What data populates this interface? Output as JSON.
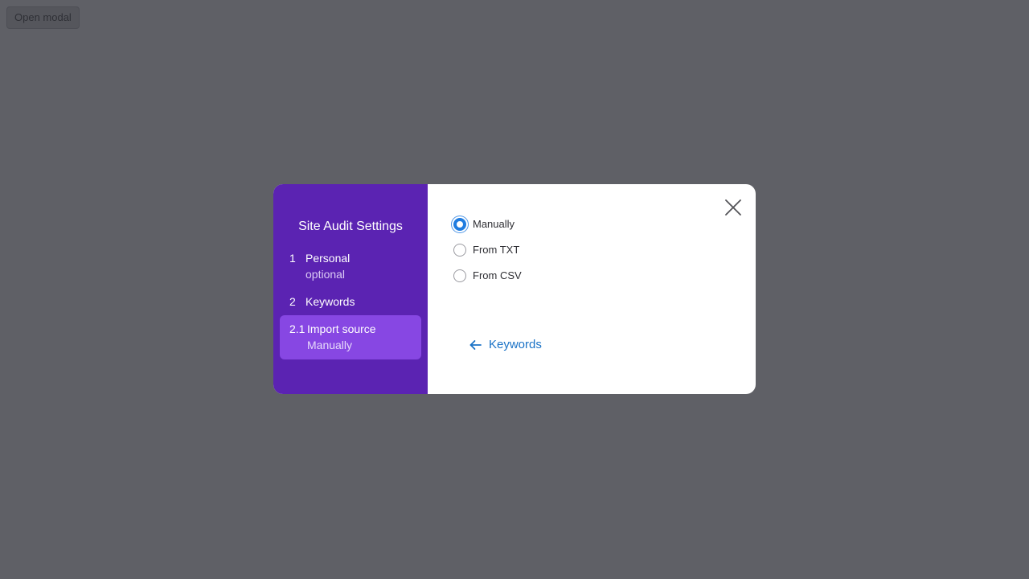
{
  "page": {
    "open_modal_label": "Open modal"
  },
  "modal": {
    "sidebar": {
      "title": "Site Audit Settings",
      "steps": [
        {
          "number": "1",
          "label": "Personal",
          "sublabel": "optional",
          "active": false
        },
        {
          "number": "2",
          "label": "Keywords",
          "sublabel": "",
          "active": false
        },
        {
          "number": "2.1",
          "label": "Import source",
          "sublabel": "Manually",
          "active": true
        }
      ]
    },
    "content": {
      "options": [
        {
          "label": "Manually",
          "checked": true
        },
        {
          "label": "From TXT",
          "checked": false
        },
        {
          "label": "From CSV",
          "checked": false
        }
      ],
      "back_link_label": "Keywords",
      "close_icon": "close-icon",
      "back_icon": "arrow-left-icon"
    }
  },
  "colors": {
    "overlay": "#5f6066",
    "sidebar_bg": "#5b23b2",
    "active_step_bg": "#8747e3",
    "accent": "#1f7ce0",
    "link": "#1a72c6"
  }
}
